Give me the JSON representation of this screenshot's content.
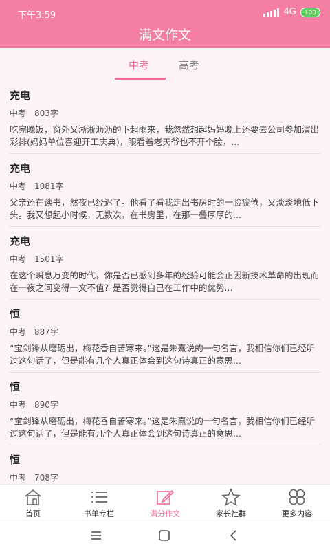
{
  "status": {
    "time": "下午3:59",
    "network": "4G",
    "battery": "100"
  },
  "app": {
    "title": "满文作文"
  },
  "tabs": [
    {
      "label": "中考",
      "active": true
    },
    {
      "label": "高考",
      "active": false
    }
  ],
  "articles": [
    {
      "title": "充电",
      "category": "中考",
      "words": "803字",
      "excerpt": "吃完晚饭，窗外又淅淅沥沥的下起雨来，我忽然想起妈妈晚上还要去公司参加演出彩排(妈妈单位喜迎开工庆典)，眼看着老天爷也不开个脸，..."
    },
    {
      "title": "充电",
      "category": "中考",
      "words": "1081字",
      "excerpt": "父亲还在读书，然夜已经迟了。他看了看我走出书房时的一脸疲倦，又淡淡地低下头。我又想起小时候，无数次，在书房里，在那一叠厚厚的..."
    },
    {
      "title": "充电",
      "category": "中考",
      "words": "1501字",
      "excerpt": "在这个瞬息万变的时代，你是否已感到多年的经验可能会正因新技术革命的出现而在一夜之间变得一文不值？是否觉得自己在工作中的优势..."
    },
    {
      "title": "恒",
      "category": "中考",
      "words": "887字",
      "excerpt": "“宝剑锋从磨砺出，梅花香自苦寒来。”这是朱熹说的一句名言，我相信你们已经听过这句话了，但是能有几个人真正体会到这句诗真正的意思..."
    },
    {
      "title": "恒",
      "category": "中考",
      "words": "890字",
      "excerpt": "“宝剑锋从磨砺出，梅花香自苦寒来。”这是朱熹说的一句名言，我相信你们已经听过这句话了，但是能有几个人真正体会到这句诗真正的意思..."
    },
    {
      "title": "恒",
      "category": "中考",
      "words": "708字",
      "excerpt": ""
    }
  ],
  "bottom_nav": [
    {
      "label": "首页",
      "icon": "home-icon",
      "active": false
    },
    {
      "label": "书单专栏",
      "icon": "list-icon",
      "active": false
    },
    {
      "label": "满分作文",
      "icon": "edit-icon",
      "active": true
    },
    {
      "label": "家长社群",
      "icon": "star-icon",
      "active": false
    },
    {
      "label": "更多内容",
      "icon": "grid-icon",
      "active": false
    }
  ],
  "colors": {
    "accent": "#f06b95",
    "header": "#f57fa3",
    "background": "#fdf3f6"
  }
}
